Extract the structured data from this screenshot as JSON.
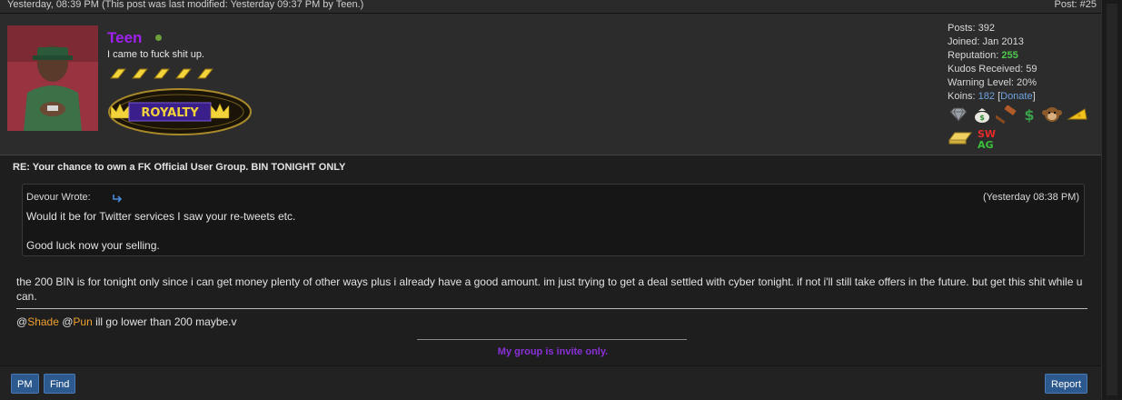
{
  "post_header": {
    "date_text": "Yesterday, 08:39 PM (This post was last modified: Yesterday 09:37 PM by Teen.)",
    "post_number": "Post: #25"
  },
  "user": {
    "username": "Teen",
    "user_title": "I came to fuck shit up.",
    "online": true,
    "star_count": 5,
    "group_badge_text": "ROYALTY"
  },
  "stats": {
    "posts_label": "Posts:",
    "posts_value": "392",
    "joined_label": "Joined:",
    "joined_value": "Jan 2013",
    "reputation_label": "Reputation:",
    "reputation_value": "255",
    "kudos_label": "Kudos Received:",
    "kudos_value": "59",
    "warning_label": "Warning Level:",
    "warning_value": "20%",
    "koins_label": "Koins:",
    "koins_value": "182",
    "donate_label": "Donate",
    "bracket_open": "[",
    "bracket_close": "]"
  },
  "awards": {
    "icons": [
      "diamond-icon",
      "money-bag-icon",
      "gavel-icon",
      "dollar-sign-icon",
      "monkey-icon",
      "cheese-icon",
      "gold-bar-icon",
      "swag-icon"
    ],
    "swag_text_top": "SW",
    "swag_text_bottom": "AG"
  },
  "post": {
    "subject": "RE: Your chance to own a FK Official User Group. BIN TONIGHT ONLY",
    "quote": {
      "author_line": "Devour Wrote:",
      "time": "(Yesterday 08:38 PM)",
      "line1": "Would it be for Twitter services I saw your re-tweets etc.",
      "line2": "Good luck now your selling."
    },
    "body": "the 200 BIN is for tonight only since i can get money plenty of other ways plus i already have a good amount. im just trying to get a deal settled with cyber tonight. if not i'll still take offers in the future. but get this shit while u can.",
    "mention_at1": "@",
    "mention_user1": "Shade",
    "mention_at2": " @",
    "mention_user2": "Pun",
    "mention_rest": " ill go lower than 200 maybe.v",
    "signature": "My group is invite only."
  },
  "buttons": {
    "pm": "PM",
    "find": "Find",
    "report": "Report"
  },
  "colors": {
    "username": "#a020f0",
    "reputation": "#4ec94e",
    "mention": "#f0a030",
    "signature": "#8a30d8",
    "button": "#2d5a8e"
  }
}
